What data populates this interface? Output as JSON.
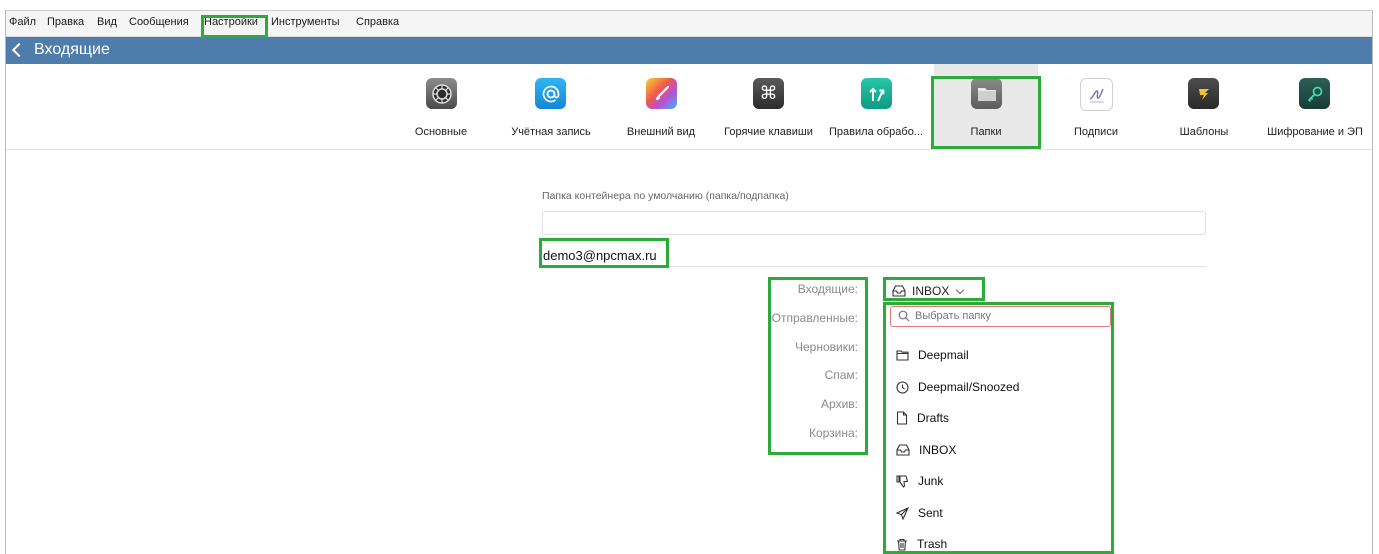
{
  "menu": [
    "Файл",
    "Правка",
    "Вид",
    "Сообщения",
    "Настройки",
    "Инструменты",
    "Справка"
  ],
  "titlebar": {
    "title": "Входящие"
  },
  "toolbar": {
    "tools": [
      {
        "label": "Основные",
        "icon": "gear-icon"
      },
      {
        "label": "Учётная запись",
        "icon": "at-sign-icon"
      },
      {
        "label": "Внешний вид",
        "icon": "brush-icon"
      },
      {
        "label": "Горячие клавиши",
        "icon": "command-key-icon"
      },
      {
        "label": "Правила обрабо...",
        "icon": "rules-arrows-icon"
      },
      {
        "label": "Папки",
        "icon": "folder-icon",
        "selected": true
      },
      {
        "label": "Подписи",
        "icon": "signature-icon"
      },
      {
        "label": "Шаблоны",
        "icon": "template-icon"
      },
      {
        "label": "Шифрование и ЭП",
        "icon": "key-icon"
      }
    ]
  },
  "folders_settings": {
    "container_label": "Папка контейнера по умолчанию (папка/подпапка)",
    "container_value": "",
    "account": "demo3@npcmax.ru",
    "fields": [
      "Входящие:",
      "Отправленные:",
      "Черновики:",
      "Спам:",
      "Архив:",
      "Корзина:"
    ],
    "inbox_value": "INBOX",
    "dropdown": {
      "search_placeholder": "Выбрать папку",
      "items": [
        {
          "label": "Deepmail",
          "icon": "folder-icon"
        },
        {
          "label": "Deepmail/Snoozed",
          "icon": "clock-icon"
        },
        {
          "label": "Drafts",
          "icon": "draft-document-icon"
        },
        {
          "label": "INBOX",
          "icon": "inbox-tray-icon"
        },
        {
          "label": "Junk",
          "icon": "thumbs-down-icon"
        },
        {
          "label": "Sent",
          "icon": "send-plane-icon"
        },
        {
          "label": "Trash",
          "icon": "trash-icon"
        }
      ]
    }
  },
  "colors": {
    "titlebar": "#4f7dab",
    "highlight": "#2cab3b",
    "search_border": "#e07a7a"
  }
}
